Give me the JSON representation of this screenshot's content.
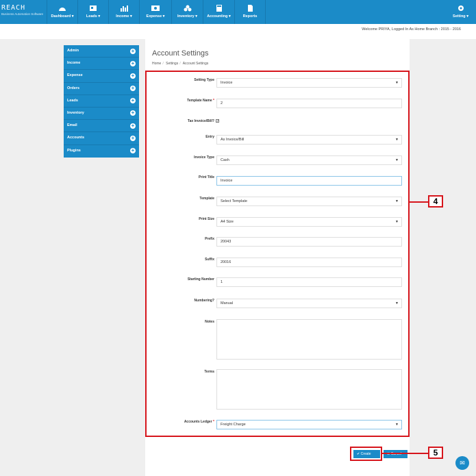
{
  "app": {
    "brand": "REACH",
    "tagline": "Business Automation Software"
  },
  "nav": [
    {
      "label": "Dashboard ▾",
      "icon": "dashboard-icon"
    },
    {
      "label": "Leads ▾",
      "icon": "leads-icon"
    },
    {
      "label": "Income ▾",
      "icon": "income-chart-icon"
    },
    {
      "label": "Expense ▾",
      "icon": "expense-icon"
    },
    {
      "label": "Inventory ▾",
      "icon": "inventory-icon"
    },
    {
      "label": "Accounting ▾",
      "icon": "accounting-icon"
    },
    {
      "label": "Reports",
      "icon": "reports-icon"
    }
  ],
  "settings_nav": {
    "label": "Setting ▾",
    "icon": "gear-icon"
  },
  "welcome": "Welcome PRIYA, Logged In As Home Branch : 2015 - 2016",
  "sidebar": {
    "items": [
      {
        "label": "Admin"
      },
      {
        "label": "Income"
      },
      {
        "label": "Expense"
      },
      {
        "label": "Orders"
      },
      {
        "label": "Leads"
      },
      {
        "label": "Inventory"
      },
      {
        "label": "Email"
      },
      {
        "label": "Accounts"
      },
      {
        "label": "Plugins"
      }
    ]
  },
  "page": {
    "title": "Account Settings",
    "breadcrumb": [
      "Home",
      "Settings",
      "Account Settings"
    ]
  },
  "form": {
    "setting_type": {
      "label": "Setting Type",
      "value": "Invoice"
    },
    "template_name": {
      "label": "Template Name",
      "value": "2"
    },
    "tax_invoice": {
      "label": "Tax Invoice/Bill?",
      "checked": "✓"
    },
    "entry": {
      "label": "Entry",
      "value": "As Invoice/Bill"
    },
    "invoice_type": {
      "label": "Invoice Type",
      "value": "Cash"
    },
    "print_title": {
      "label": "Print Title",
      "value": "Invoice"
    },
    "template": {
      "label": "Template",
      "value": "Select Template"
    },
    "print_size": {
      "label": "Print Size",
      "value": "A4 Size"
    },
    "prefix": {
      "label": "Prefix",
      "value": "20043"
    },
    "suffix": {
      "label": "Suffix",
      "value": "20016"
    },
    "starting_number": {
      "label": "Starting Number",
      "value": "1"
    },
    "numbering": {
      "label": "Numbering?",
      "value": "Manual"
    },
    "notes": {
      "label": "Notes",
      "value": ""
    },
    "terms": {
      "label": "Terms",
      "value": ""
    },
    "accounts_ledger": {
      "label": "Accounts Ledger",
      "value": "Freight Charge"
    }
  },
  "buttons": {
    "create": "✔ Create",
    "cancel": "✖ Cancel"
  },
  "callouts": {
    "form": "4",
    "create": "5"
  },
  "colors": {
    "brand": "#1b8bc8",
    "callout": "#d6151c"
  }
}
